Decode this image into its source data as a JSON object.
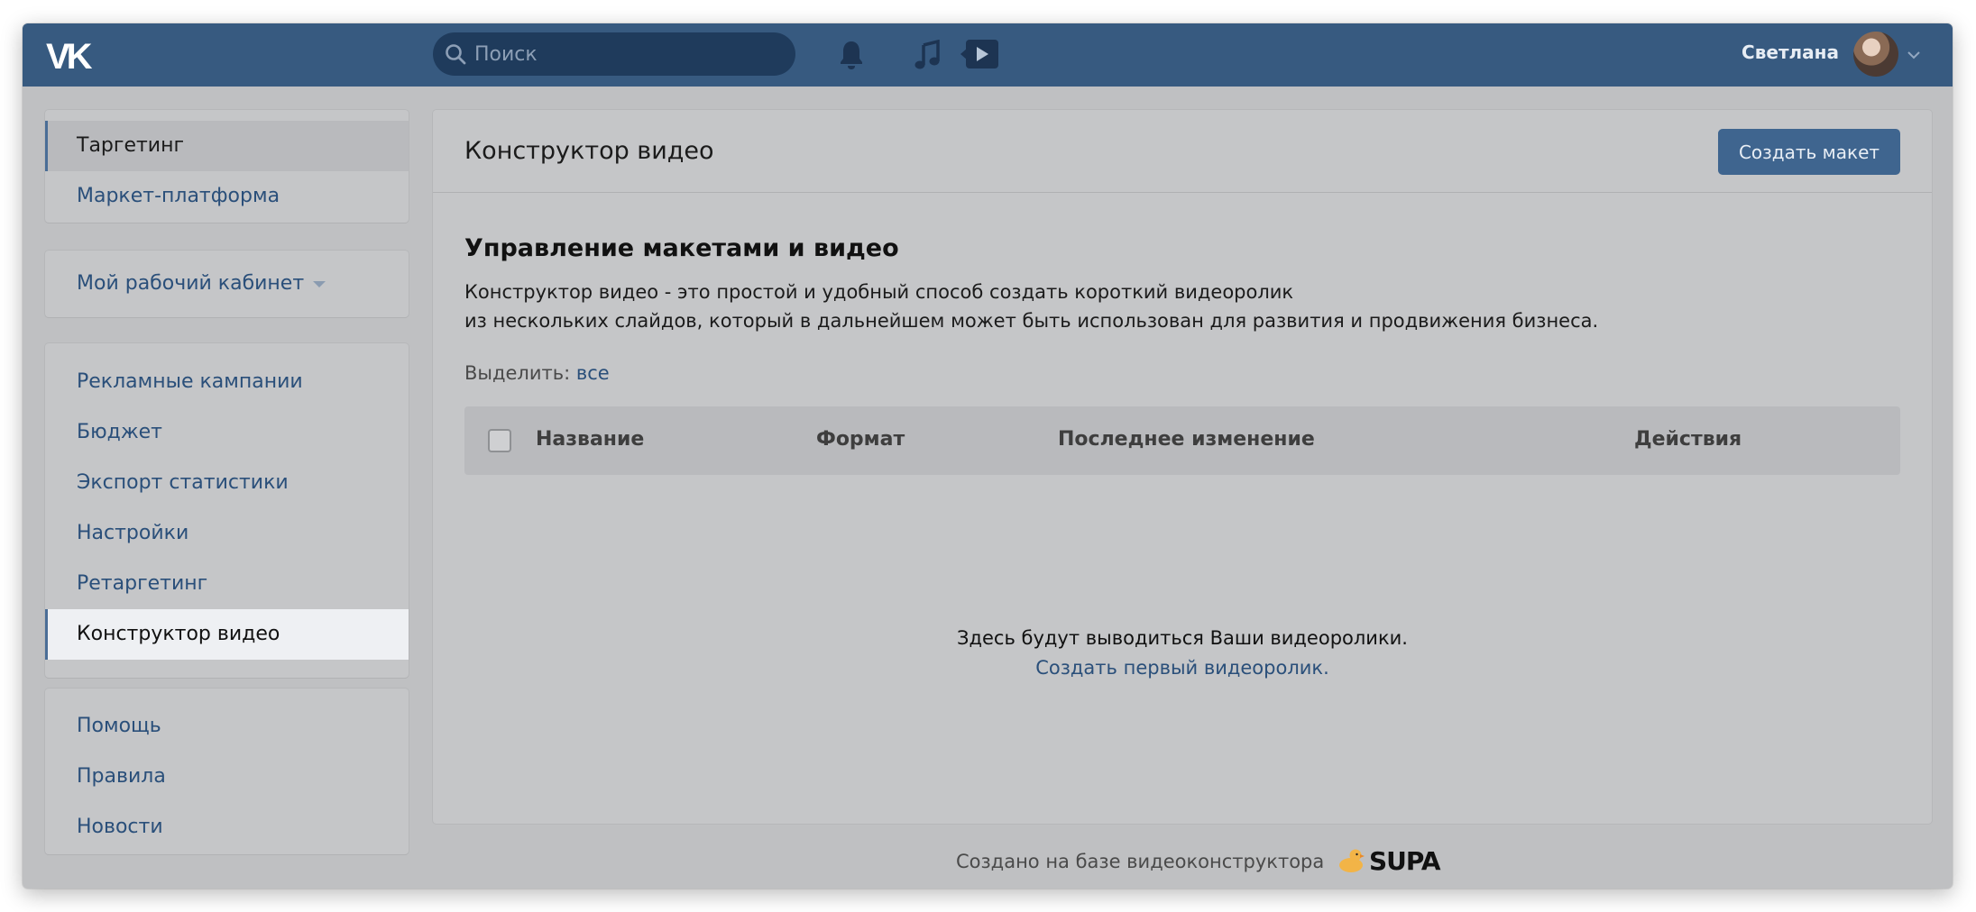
{
  "header": {
    "search_placeholder": "Поиск",
    "user_name": "Светлана"
  },
  "sidebar": {
    "group1": [
      {
        "label": "Таргетинг",
        "active": true
      },
      {
        "label": "Маркет-платформа"
      }
    ],
    "cabinet": {
      "label": "Мой рабочий кабинет"
    },
    "group2": [
      {
        "label": "Рекламные кампании"
      },
      {
        "label": "Бюджет"
      },
      {
        "label": "Экспорт статистики"
      },
      {
        "label": "Настройки"
      },
      {
        "label": "Ретаргетинг"
      },
      {
        "label": "Конструктор видео",
        "active": true
      }
    ],
    "group3": [
      {
        "label": "Помощь"
      },
      {
        "label": "Правила"
      },
      {
        "label": "Новости"
      }
    ]
  },
  "main": {
    "title": "Конструктор видео",
    "create_button": "Создать макет",
    "section_title": "Управление макетами и видео",
    "description_line1": "Конструктор видео - это простой и удобный способ создать короткий видеоролик",
    "description_line2": "из нескольких слайдов, который в дальнейшем может быть использован для развития и продвижения бизнеса.",
    "select_label": "Выделить:",
    "select_all": "все",
    "table_headers": [
      "Название",
      "Формат",
      "Последнее изменение",
      "Действия"
    ],
    "empty_text": "Здесь будут выводиться Ваши видеоролики.",
    "empty_link": "Создать первый видеоролик."
  },
  "footer": {
    "text": "Создано на базе видеоконструктора",
    "brand": "SUPA"
  },
  "colors": {
    "header_bg": "#375a80",
    "accent": "#3f658f",
    "link": "#2a4f7a"
  }
}
